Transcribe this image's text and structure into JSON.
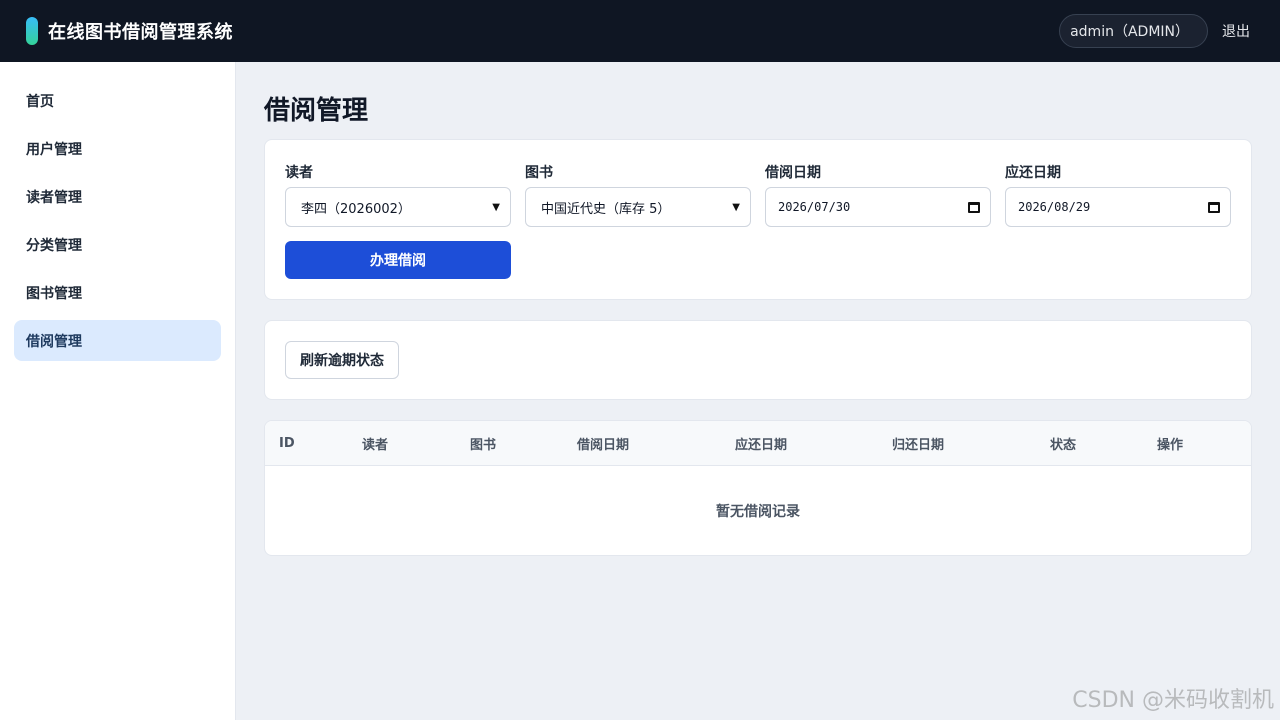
{
  "header": {
    "title": "在线图书借阅管理系统",
    "user": "admin（ADMIN）",
    "logout": "退出"
  },
  "sidebar": {
    "items": [
      {
        "label": "首页"
      },
      {
        "label": "用户管理"
      },
      {
        "label": "读者管理"
      },
      {
        "label": "分类管理"
      },
      {
        "label": "图书管理"
      },
      {
        "label": "借阅管理",
        "active": true
      }
    ]
  },
  "page": {
    "title": "借阅管理"
  },
  "form": {
    "reader_label": "读者",
    "reader_value": "李四（2026002）",
    "book_label": "图书",
    "book_value": "中国近代史（库存 5）",
    "borrow_date_label": "借阅日期",
    "borrow_date_value": "2026/07/30",
    "due_date_label": "应还日期",
    "due_date_value": "2026/08/29",
    "submit_label": "办理借阅"
  },
  "tools": {
    "refresh_label": "刷新逾期状态"
  },
  "table": {
    "columns": [
      "ID",
      "读者",
      "图书",
      "借阅日期",
      "应还日期",
      "归还日期",
      "状态",
      "操作"
    ],
    "empty_text": "暂无借阅记录"
  },
  "watermark": "CSDN @米码收割机",
  "colors": {
    "header_bg": "#0f1623",
    "primary": "#1d4ed8",
    "active_nav": "#dbeafe"
  }
}
